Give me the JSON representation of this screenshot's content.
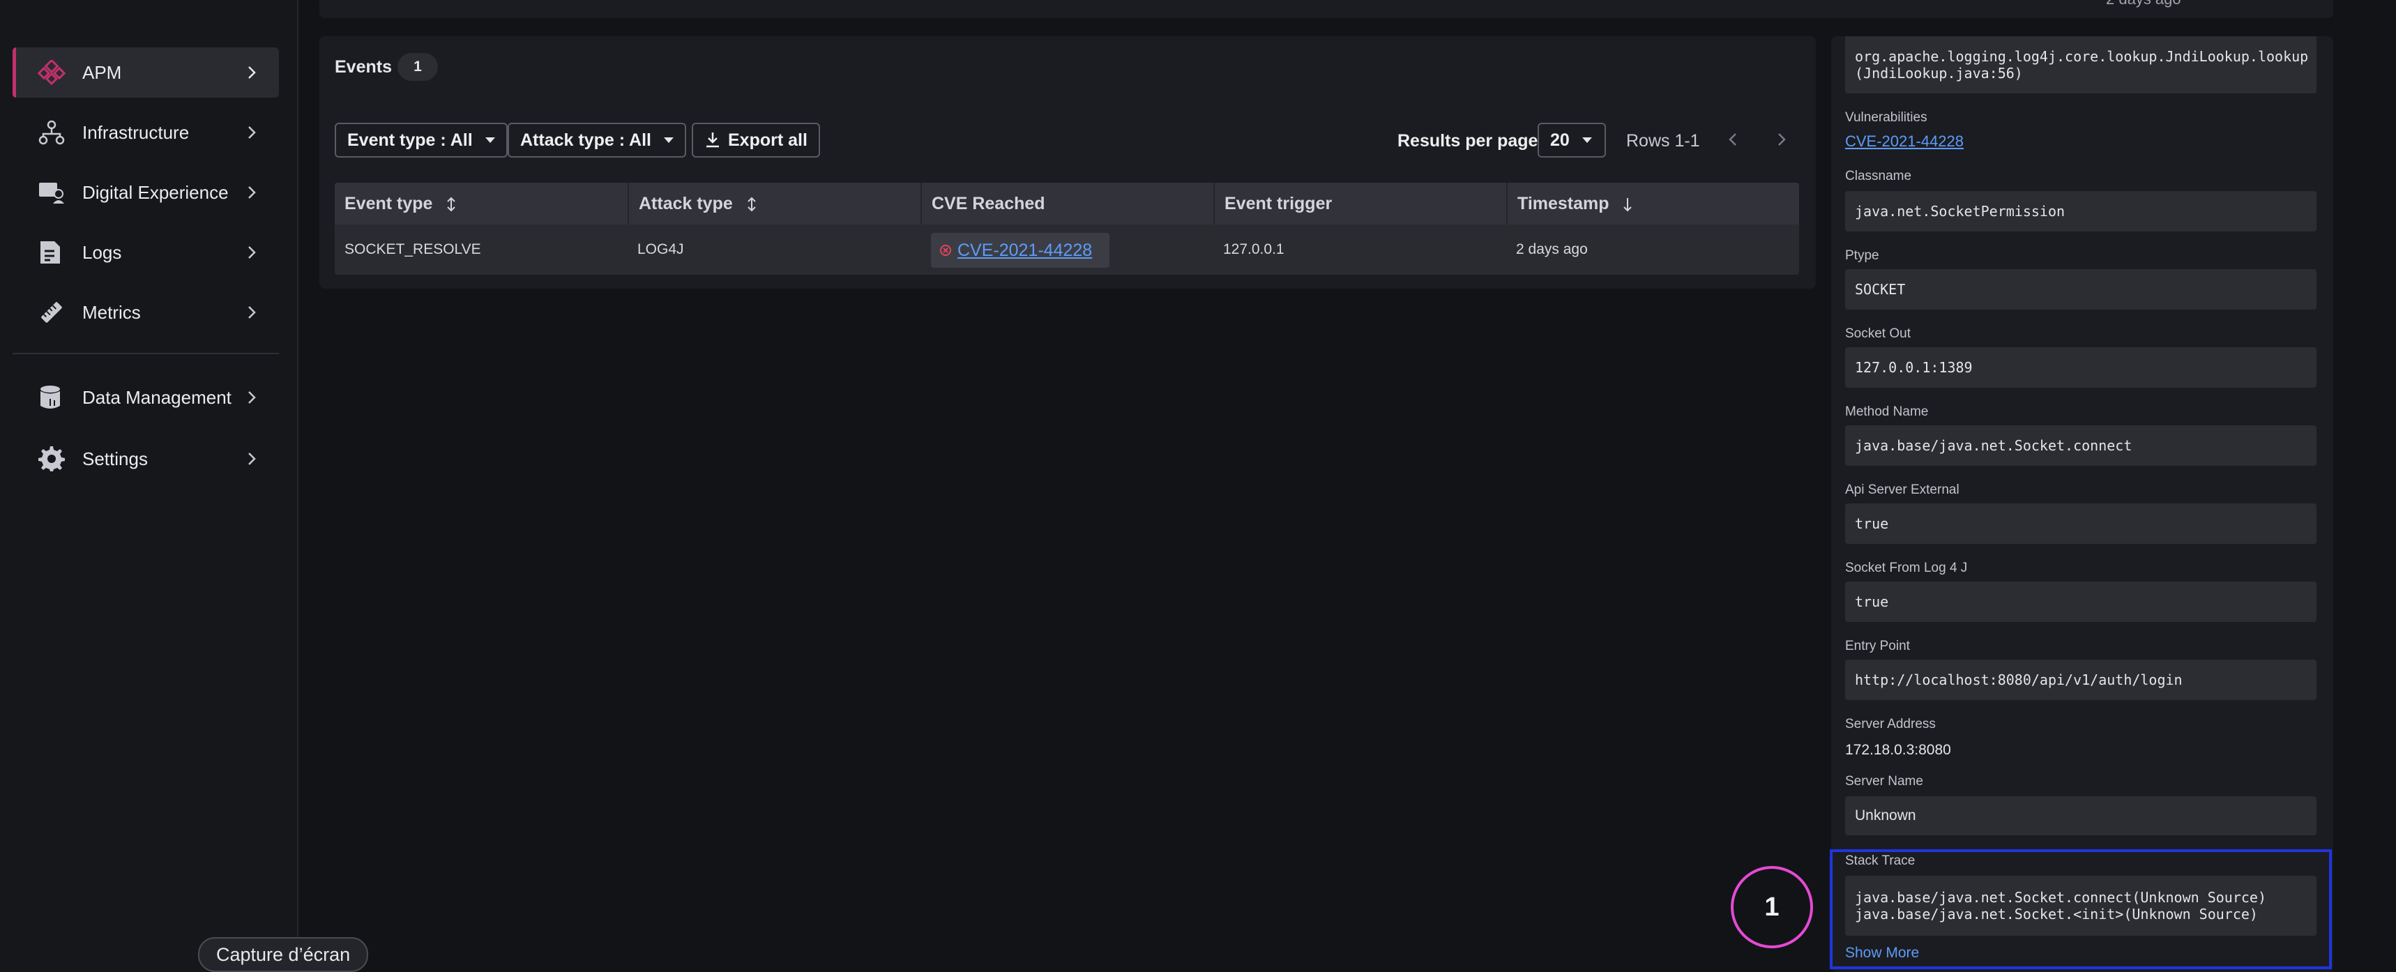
{
  "sidebar": {
    "items": [
      {
        "label": "APM",
        "icon": "apm-icon",
        "active": true
      },
      {
        "label": "Infrastructure",
        "icon": "infrastructure-icon"
      },
      {
        "label": "Digital Experience",
        "icon": "digital-experience-icon"
      },
      {
        "label": "Logs",
        "icon": "logs-icon"
      },
      {
        "label": "Metrics",
        "icon": "metrics-icon"
      }
    ],
    "bottom_items": [
      {
        "label": "Data Management",
        "icon": "database-icon"
      },
      {
        "label": "Settings",
        "icon": "gear-icon"
      }
    ]
  },
  "topbar": {
    "timestamp": "2 days ago"
  },
  "events": {
    "title": "Events",
    "count": "1",
    "filters": {
      "event_type": "Event type : All",
      "attack_type": "Attack type : All",
      "export": "Export all"
    },
    "pagination": {
      "results_per_page_label": "Results per page",
      "results_per_page_value": "20",
      "rows_label": "Rows 1-1"
    },
    "table": {
      "headers": [
        "Event type",
        "Attack type",
        "CVE Reached",
        "Event trigger",
        "Timestamp"
      ],
      "rows": [
        {
          "event_type": "SOCKET_RESOLVE",
          "attack_type": "LOG4J",
          "cve": "CVE-2021-44228",
          "trigger": "127.0.0.1",
          "timestamp": "2 days ago"
        }
      ]
    }
  },
  "details": {
    "top_value_line1": "org.apache.logging.log4j.core.lookup.JndiLookup.lookup",
    "top_value_line2": "(JndiLookup.java:56)",
    "vulnerabilities_label": "Vulnerabilities",
    "vulnerabilities_value": "CVE-2021-44228",
    "classname_label": "Classname",
    "classname_value": "java.net.SocketPermission",
    "ptype_label": "Ptype",
    "ptype_value": "SOCKET",
    "socket_out_label": "Socket Out",
    "socket_out_value": "127.0.0.1:1389",
    "method_name_label": "Method Name",
    "method_name_value": "java.base/java.net.Socket.connect",
    "api_server_external_label": "Api Server External",
    "api_server_external_value": "true",
    "socket_from_log4j_label": "Socket From Log 4 J",
    "socket_from_log4j_value": "true",
    "entry_point_label": "Entry Point",
    "entry_point_value": "http://localhost:8080/api/v1/auth/login",
    "server_address_label": "Server Address",
    "server_address_value": "172.18.0.3:8080",
    "server_name_label": "Server Name",
    "server_name_value": "Unknown",
    "stack_trace_label": "Stack Trace",
    "stack_trace_line1": "java.base/java.net.Socket.connect(Unknown Source)",
    "stack_trace_line2": "java.base/java.net.Socket.<init>(Unknown Source)",
    "show_more": "Show More"
  },
  "annotation": {
    "number": "1"
  },
  "toast": {
    "label": "Capture d’écran"
  },
  "colors": {
    "accent": "#c2306c",
    "link": "#5d9cf8",
    "highlight": "#1f35e0",
    "annotation": "#e44ad3"
  }
}
